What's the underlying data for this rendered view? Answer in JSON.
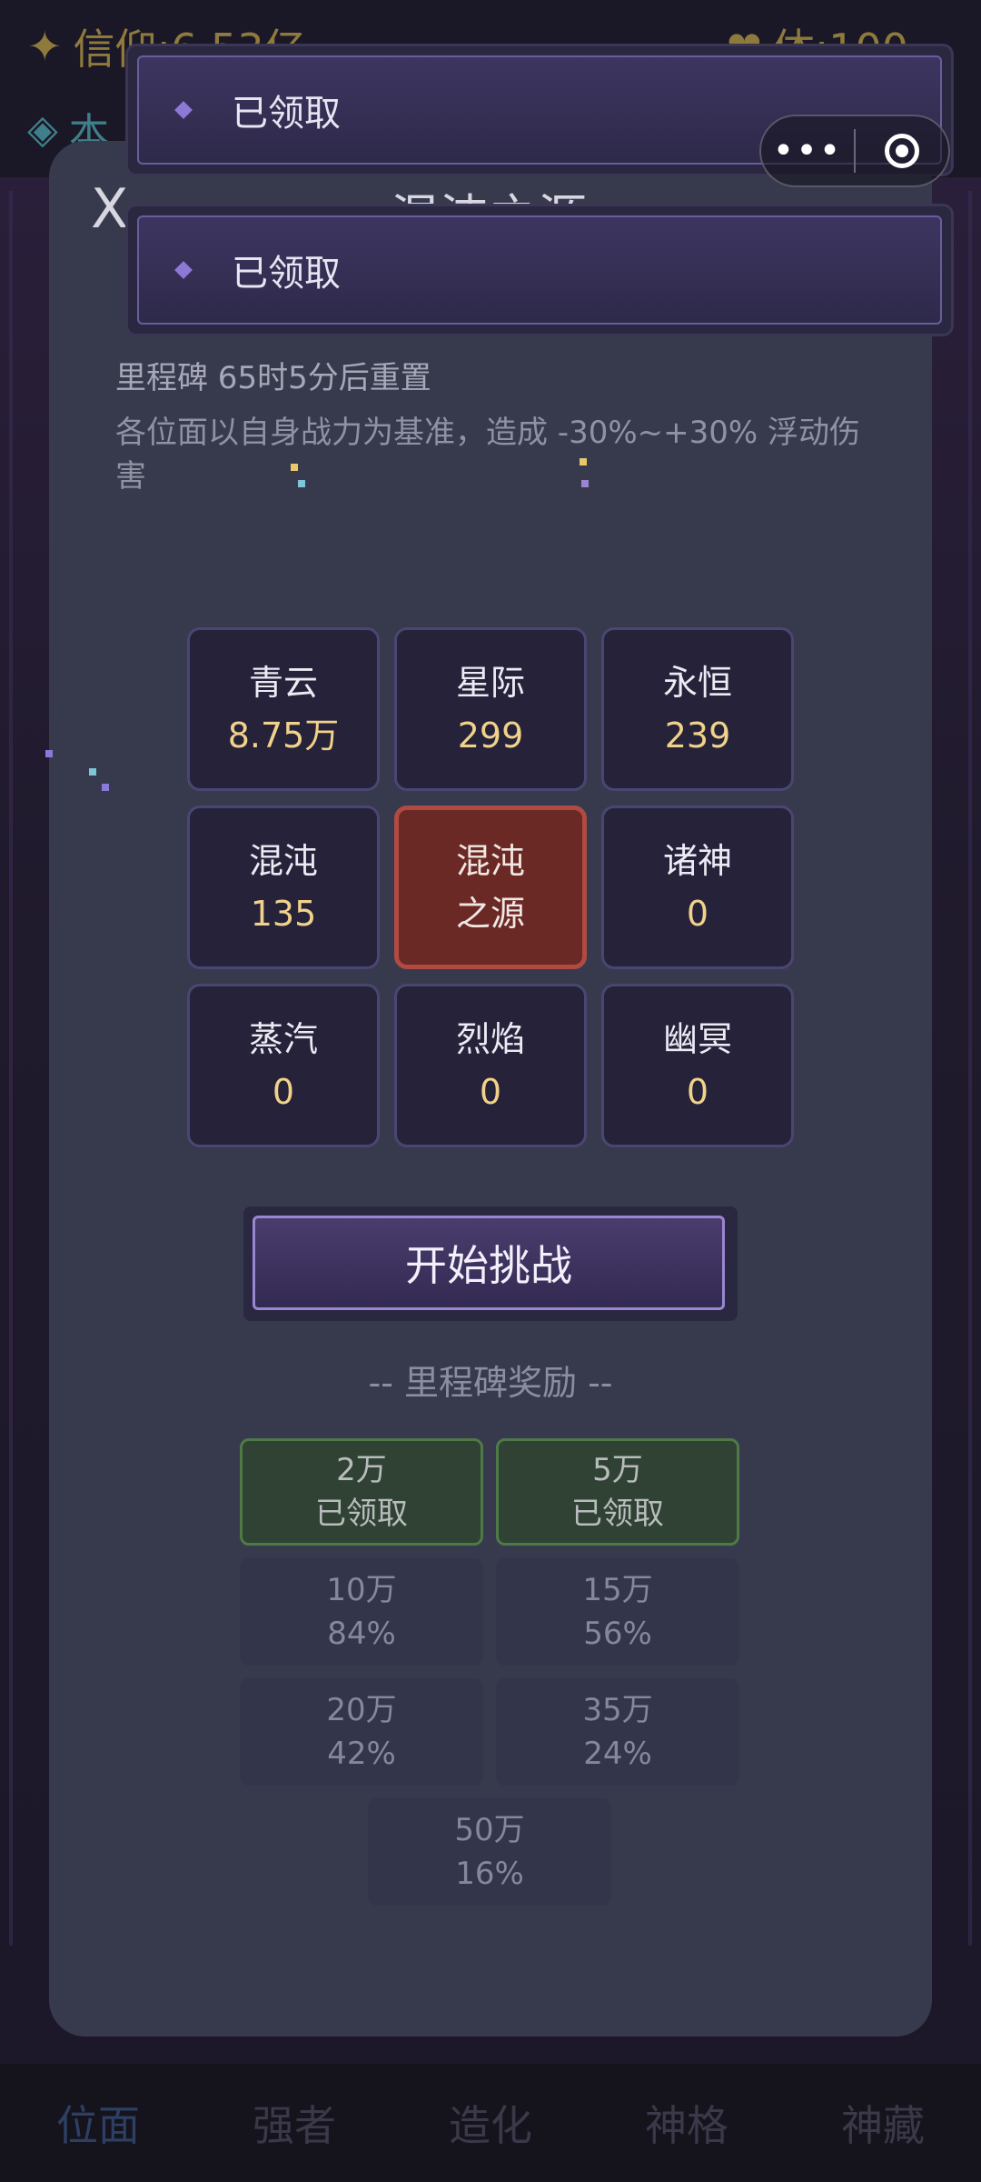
{
  "background": {
    "faith_label": "信仰:6.53亿",
    "stamina_label": "体:100",
    "sub_label": "本"
  },
  "toasts": [
    "已领取",
    "已领取"
  ],
  "capsule": {
    "more_icon": "more-icon",
    "record_icon": "record-icon"
  },
  "modal": {
    "close_label": "X",
    "title": "混沌之源",
    "reset_text": "里程碑 65时5分后重置",
    "description": "各位面以自身战力为基准，造成 -30%~+30% 浮动伤害"
  },
  "planes": [
    {
      "name": "青云",
      "value": "8.75万"
    },
    {
      "name": "星际",
      "value": "299"
    },
    {
      "name": "永恒",
      "value": "239"
    },
    {
      "name": "混沌",
      "value": "135"
    },
    {
      "name": "混沌之源",
      "line1": "混沌",
      "line2": "之源",
      "selected": true
    },
    {
      "name": "诸神",
      "value": "0"
    },
    {
      "name": "蒸汽",
      "value": "0"
    },
    {
      "name": "烈焰",
      "value": "0"
    },
    {
      "name": "幽冥",
      "value": "0"
    }
  ],
  "start_button": "开始挑战",
  "milestone_header": "-- 里程碑奖励 --",
  "rewards": [
    {
      "amount": "2万",
      "status": "已领取",
      "claimed": true
    },
    {
      "amount": "5万",
      "status": "已领取",
      "claimed": true
    },
    {
      "amount": "10万",
      "status": "84%",
      "claimed": false
    },
    {
      "amount": "15万",
      "status": "56%",
      "claimed": false
    },
    {
      "amount": "20万",
      "status": "42%",
      "claimed": false
    },
    {
      "amount": "35万",
      "status": "24%",
      "claimed": false
    },
    {
      "amount": "50万",
      "status": "16%",
      "claimed": false
    }
  ],
  "tabs": [
    "位面",
    "强者",
    "造化",
    "神格",
    "神藏"
  ],
  "colors": {
    "accent": "#9a86d0",
    "gold": "#f1d28a",
    "selected": "#6b2926",
    "claimed": "#2f4234"
  }
}
